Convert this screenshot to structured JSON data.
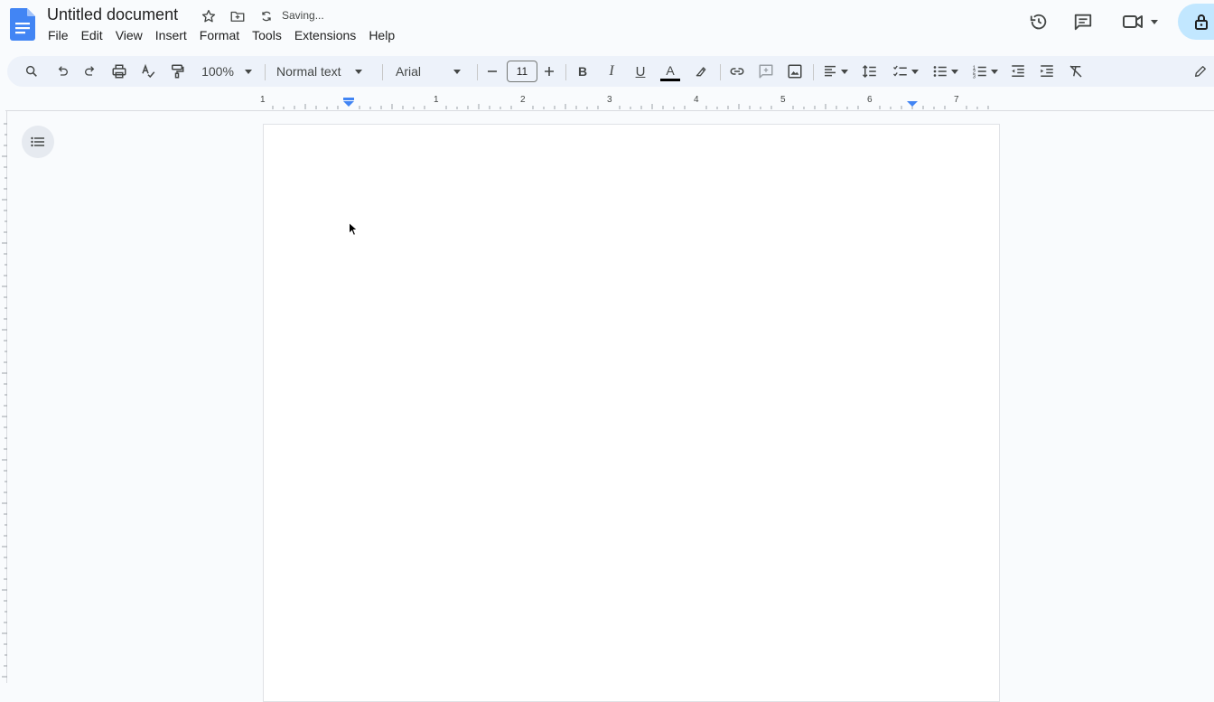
{
  "doc": {
    "title": "Untitled document",
    "status": "Saving...",
    "accent": "#4285f4"
  },
  "menu": {
    "items": [
      "File",
      "Edit",
      "View",
      "Insert",
      "Format",
      "Tools",
      "Extensions",
      "Help"
    ]
  },
  "toolbar": {
    "zoom": "100%",
    "style": "Normal text",
    "font": "Arial",
    "font_size": "11",
    "bold": "B",
    "italic": "I",
    "underline": "U",
    "text_color": "A"
  },
  "ruler": {
    "labels": [
      "1",
      "1",
      "2",
      "3",
      "4",
      "5",
      "6",
      "7"
    ]
  },
  "icons": {
    "header": [
      "docs-logo-icon",
      "star-icon",
      "move-to-folder-icon",
      "sync-icon"
    ],
    "right": [
      "history-icon",
      "comment-icon",
      "meet-video-icon",
      "lock-icon"
    ],
    "toolbar": [
      "search-icon",
      "undo-icon",
      "redo-icon",
      "print-icon",
      "spellcheck-icon",
      "paint-format-icon",
      "highlighter-icon",
      "link-icon",
      "add-comment-icon",
      "image-icon",
      "align-left-icon",
      "line-spacing-icon",
      "checklist-icon",
      "bulleted-list-icon",
      "numbered-list-icon",
      "decrease-indent-icon",
      "increase-indent-icon",
      "clear-formatting-icon",
      "editing-mode-pencil-icon"
    ],
    "side": [
      "outline-icon"
    ]
  }
}
